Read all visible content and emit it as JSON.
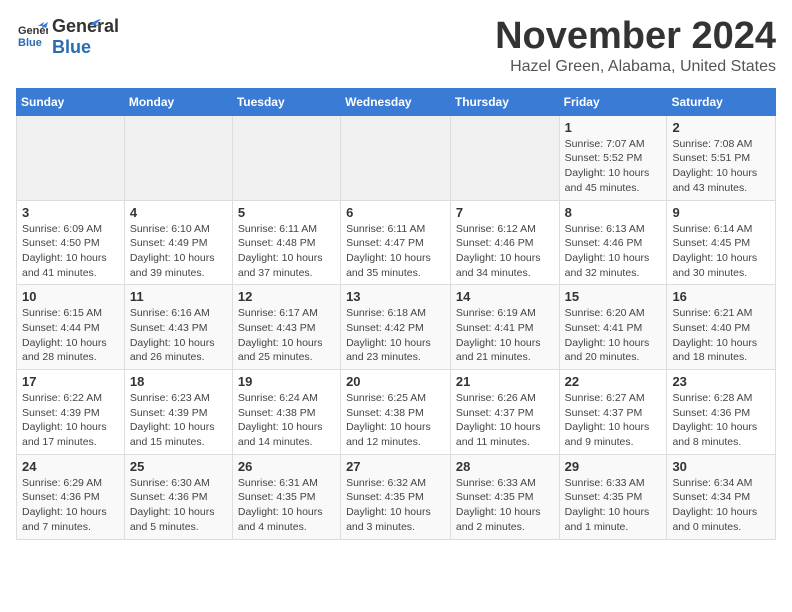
{
  "header": {
    "logo_line1": "General",
    "logo_line2": "Blue",
    "month": "November 2024",
    "location": "Hazel Green, Alabama, United States"
  },
  "weekdays": [
    "Sunday",
    "Monday",
    "Tuesday",
    "Wednesday",
    "Thursday",
    "Friday",
    "Saturday"
  ],
  "weeks": [
    [
      {
        "day": "",
        "info": ""
      },
      {
        "day": "",
        "info": ""
      },
      {
        "day": "",
        "info": ""
      },
      {
        "day": "",
        "info": ""
      },
      {
        "day": "",
        "info": ""
      },
      {
        "day": "1",
        "info": "Sunrise: 7:07 AM\nSunset: 5:52 PM\nDaylight: 10 hours and 45 minutes."
      },
      {
        "day": "2",
        "info": "Sunrise: 7:08 AM\nSunset: 5:51 PM\nDaylight: 10 hours and 43 minutes."
      }
    ],
    [
      {
        "day": "3",
        "info": "Sunrise: 6:09 AM\nSunset: 4:50 PM\nDaylight: 10 hours and 41 minutes."
      },
      {
        "day": "4",
        "info": "Sunrise: 6:10 AM\nSunset: 4:49 PM\nDaylight: 10 hours and 39 minutes."
      },
      {
        "day": "5",
        "info": "Sunrise: 6:11 AM\nSunset: 4:48 PM\nDaylight: 10 hours and 37 minutes."
      },
      {
        "day": "6",
        "info": "Sunrise: 6:11 AM\nSunset: 4:47 PM\nDaylight: 10 hours and 35 minutes."
      },
      {
        "day": "7",
        "info": "Sunrise: 6:12 AM\nSunset: 4:46 PM\nDaylight: 10 hours and 34 minutes."
      },
      {
        "day": "8",
        "info": "Sunrise: 6:13 AM\nSunset: 4:46 PM\nDaylight: 10 hours and 32 minutes."
      },
      {
        "day": "9",
        "info": "Sunrise: 6:14 AM\nSunset: 4:45 PM\nDaylight: 10 hours and 30 minutes."
      }
    ],
    [
      {
        "day": "10",
        "info": "Sunrise: 6:15 AM\nSunset: 4:44 PM\nDaylight: 10 hours and 28 minutes."
      },
      {
        "day": "11",
        "info": "Sunrise: 6:16 AM\nSunset: 4:43 PM\nDaylight: 10 hours and 26 minutes."
      },
      {
        "day": "12",
        "info": "Sunrise: 6:17 AM\nSunset: 4:43 PM\nDaylight: 10 hours and 25 minutes."
      },
      {
        "day": "13",
        "info": "Sunrise: 6:18 AM\nSunset: 4:42 PM\nDaylight: 10 hours and 23 minutes."
      },
      {
        "day": "14",
        "info": "Sunrise: 6:19 AM\nSunset: 4:41 PM\nDaylight: 10 hours and 21 minutes."
      },
      {
        "day": "15",
        "info": "Sunrise: 6:20 AM\nSunset: 4:41 PM\nDaylight: 10 hours and 20 minutes."
      },
      {
        "day": "16",
        "info": "Sunrise: 6:21 AM\nSunset: 4:40 PM\nDaylight: 10 hours and 18 minutes."
      }
    ],
    [
      {
        "day": "17",
        "info": "Sunrise: 6:22 AM\nSunset: 4:39 PM\nDaylight: 10 hours and 17 minutes."
      },
      {
        "day": "18",
        "info": "Sunrise: 6:23 AM\nSunset: 4:39 PM\nDaylight: 10 hours and 15 minutes."
      },
      {
        "day": "19",
        "info": "Sunrise: 6:24 AM\nSunset: 4:38 PM\nDaylight: 10 hours and 14 minutes."
      },
      {
        "day": "20",
        "info": "Sunrise: 6:25 AM\nSunset: 4:38 PM\nDaylight: 10 hours and 12 minutes."
      },
      {
        "day": "21",
        "info": "Sunrise: 6:26 AM\nSunset: 4:37 PM\nDaylight: 10 hours and 11 minutes."
      },
      {
        "day": "22",
        "info": "Sunrise: 6:27 AM\nSunset: 4:37 PM\nDaylight: 10 hours and 9 minutes."
      },
      {
        "day": "23",
        "info": "Sunrise: 6:28 AM\nSunset: 4:36 PM\nDaylight: 10 hours and 8 minutes."
      }
    ],
    [
      {
        "day": "24",
        "info": "Sunrise: 6:29 AM\nSunset: 4:36 PM\nDaylight: 10 hours and 7 minutes."
      },
      {
        "day": "25",
        "info": "Sunrise: 6:30 AM\nSunset: 4:36 PM\nDaylight: 10 hours and 5 minutes."
      },
      {
        "day": "26",
        "info": "Sunrise: 6:31 AM\nSunset: 4:35 PM\nDaylight: 10 hours and 4 minutes."
      },
      {
        "day": "27",
        "info": "Sunrise: 6:32 AM\nSunset: 4:35 PM\nDaylight: 10 hours and 3 minutes."
      },
      {
        "day": "28",
        "info": "Sunrise: 6:33 AM\nSunset: 4:35 PM\nDaylight: 10 hours and 2 minutes."
      },
      {
        "day": "29",
        "info": "Sunrise: 6:33 AM\nSunset: 4:35 PM\nDaylight: 10 hours and 1 minute."
      },
      {
        "day": "30",
        "info": "Sunrise: 6:34 AM\nSunset: 4:34 PM\nDaylight: 10 hours and 0 minutes."
      }
    ]
  ]
}
